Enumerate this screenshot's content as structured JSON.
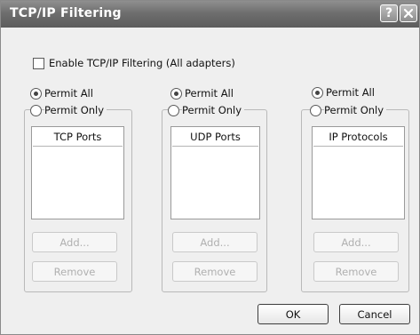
{
  "window": {
    "title": "TCP/IP Filtering"
  },
  "enable_checkbox": {
    "label": "Enable TCP/IP Filtering (All adapters)",
    "checked": false
  },
  "groups": [
    {
      "permit_all_label": "Permit All",
      "permit_only_label": "Permit Only",
      "selected": "permit_all",
      "list_header": "TCP Ports",
      "add_label": "Add...",
      "remove_label": "Remove"
    },
    {
      "permit_all_label": "Permit All",
      "permit_only_label": "Permit Only",
      "selected": "permit_all",
      "list_header": "UDP Ports",
      "add_label": "Add...",
      "remove_label": "Remove"
    },
    {
      "permit_all_label": "Permit All",
      "permit_only_label": "Permit Only",
      "selected": "permit_all",
      "list_header": "IP Protocols",
      "add_label": "Add...",
      "remove_label": "Remove"
    }
  ],
  "footer": {
    "ok_label": "OK",
    "cancel_label": "Cancel"
  }
}
